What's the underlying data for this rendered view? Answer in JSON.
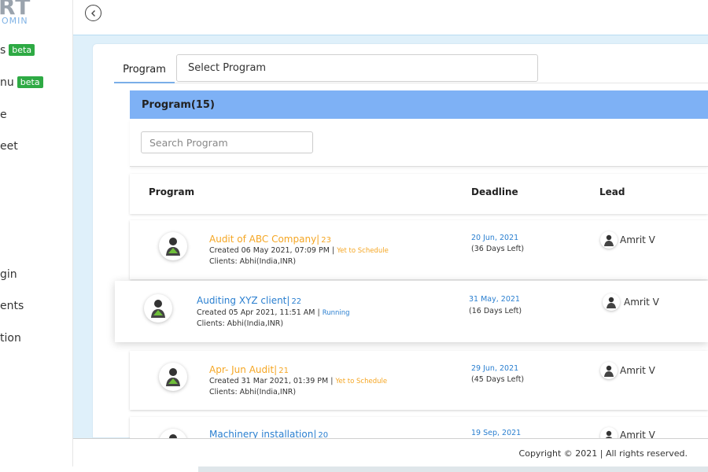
{
  "logo": {
    "line1": "RT",
    "line2": "OMIN"
  },
  "sidebar": {
    "items": [
      {
        "label": "s",
        "badge": "beta"
      },
      {
        "label": "nu",
        "badge": "beta"
      },
      {
        "label": "e"
      },
      {
        "label": "eet"
      },
      {
        "label": "gin"
      },
      {
        "label": "ents"
      },
      {
        "label": "tion"
      }
    ]
  },
  "tabs": {
    "program": "Program"
  },
  "select_program": {
    "placeholder": "Select Program"
  },
  "panel": {
    "title": "Program(15)"
  },
  "search": {
    "placeholder": "Search Program"
  },
  "columns": {
    "program": "Program",
    "deadline": "Deadline",
    "lead": "Lead"
  },
  "colors": {
    "accent": "#7eb1f5",
    "orange": "#f5a623",
    "blue": "#2a7fd0"
  },
  "programs": [
    {
      "name": "Audit of ABC Company|",
      "count": "23",
      "created": "Created 06 May 2021, 07:09 PM |",
      "status": "Yet to Schedule",
      "clients": "Clients: Abhi(India,INR)",
      "deadline": "20 Jun, 2021",
      "days_left": "(36 Days Left)",
      "lead": "Amrit V"
    },
    {
      "name": "Auditing XYZ client|",
      "count": "22",
      "created": "Created 05 Apr 2021, 11:51 AM |",
      "status": "Running",
      "clients": "Clients: Abhi(India,INR)",
      "deadline": "31 May, 2021",
      "days_left": "(16 Days Left)",
      "lead": "Amrit V"
    },
    {
      "name": "Apr- Jun Audit|",
      "count": "21",
      "created": "Created 31 Mar 2021, 01:39 PM |",
      "status": "Yet to Schedule",
      "clients": "Clients: Abhi(India,INR)",
      "deadline": "29 Jun, 2021",
      "days_left": "(45 Days Left)",
      "lead": "Amrit V"
    },
    {
      "name": "Machinery installation|",
      "count": "20",
      "deadline": "19 Sep, 2021",
      "lead": "Amrit V"
    }
  ],
  "footer": {
    "copyright": "Copyright © 2021 | All rights reserved."
  }
}
